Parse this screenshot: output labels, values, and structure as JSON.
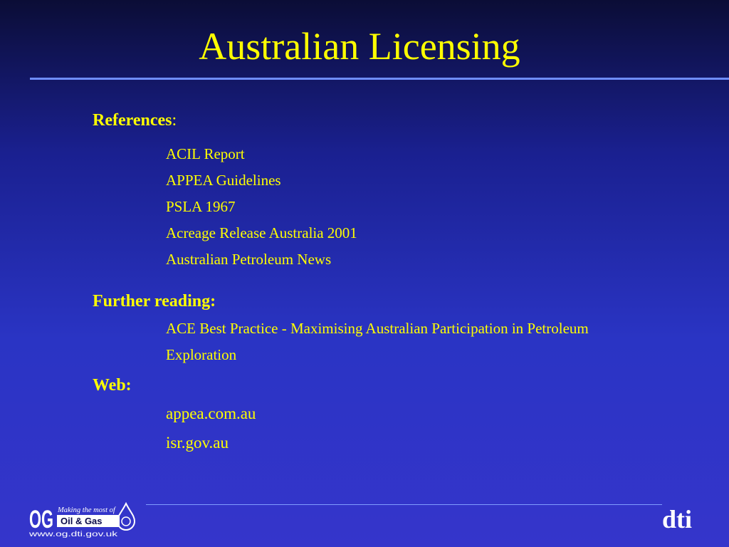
{
  "slide": {
    "title": "Australian Licensing",
    "references": {
      "heading": "References",
      "colon": ":",
      "items": [
        "ACIL Report",
        "APPEA Guidelines",
        "PSLA 1967",
        "Acreage Release Australia 2001",
        "Australian Petroleum News"
      ]
    },
    "further_reading": {
      "heading": "Further reading:",
      "items": [
        "ACE Best Practice - Maximising Australian Participation in Petroleum",
        "Exploration"
      ]
    },
    "web": {
      "heading": "Web:",
      "items": [
        "appea.com.au",
        "isr.gov.au"
      ]
    }
  },
  "footer": {
    "og_logo": {
      "letters": "OG",
      "tagline": "Making the most of",
      "name": "Oil & Gas",
      "url": "www.og.dti.gov.uk"
    },
    "dti_logo": "dti"
  },
  "colors": {
    "text": "#ffff00",
    "background_top": "#0b0d36",
    "background_bottom": "#3535cb",
    "rule": "#6f8dff"
  }
}
